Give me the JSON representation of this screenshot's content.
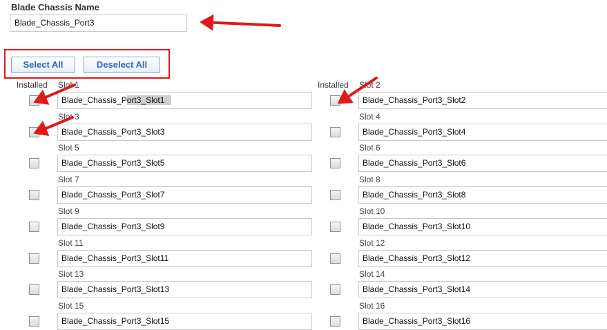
{
  "chassis": {
    "label": "Blade Chassis Name",
    "value": "Blade_Chassis_Port3"
  },
  "buttons": {
    "select_all": "Select All",
    "deselect_all": "Deselect All"
  },
  "column_headers": {
    "left_installed": "Installed",
    "left_slot": "Slot 1",
    "right_installed": "Installed",
    "right_slot": "Slot 2"
  },
  "slots": [
    {
      "label": "Slot 1",
      "value": "Blade_Chassis_Port3_Slot1",
      "installed": false
    },
    {
      "label": "Slot 2",
      "value": "Blade_Chassis_Port3_Slot2",
      "installed": false
    },
    {
      "label": "Slot 3",
      "value": "Blade_Chassis_Port3_Slot3",
      "installed": false
    },
    {
      "label": "Slot 4",
      "value": "Blade_Chassis_Port3_Slot4",
      "installed": false
    },
    {
      "label": "Slot 5",
      "value": "Blade_Chassis_Port3_Slot5",
      "installed": false
    },
    {
      "label": "Slot 6",
      "value": "Blade_Chassis_Port3_Slot6",
      "installed": false
    },
    {
      "label": "Slot 7",
      "value": "Blade_Chassis_Port3_Slot7",
      "installed": false
    },
    {
      "label": "Slot 8",
      "value": "Blade_Chassis_Port3_Slot8",
      "installed": false
    },
    {
      "label": "Slot 9",
      "value": "Blade_Chassis_Port3_Slot9",
      "installed": false
    },
    {
      "label": "Slot 10",
      "value": "Blade_Chassis_Port3_Slot10",
      "installed": false
    },
    {
      "label": "Slot 11",
      "value": "Blade_Chassis_Port3_Slot11",
      "installed": false
    },
    {
      "label": "Slot 12",
      "value": "Blade_Chassis_Port3_Slot12",
      "installed": false
    },
    {
      "label": "Slot 13",
      "value": "Blade_Chassis_Port3_Slot13",
      "installed": false
    },
    {
      "label": "Slot 14",
      "value": "Blade_Chassis_Port3_Slot14",
      "installed": false
    },
    {
      "label": "Slot 15",
      "value": "Blade_Chassis_Port3_Slot15",
      "installed": false
    },
    {
      "label": "Slot 16",
      "value": "Blade_Chassis_Port3_Slot16",
      "installed": false
    }
  ],
  "colors": {
    "annotation_red": "#e01919",
    "button_text": "#2a6bb8"
  }
}
